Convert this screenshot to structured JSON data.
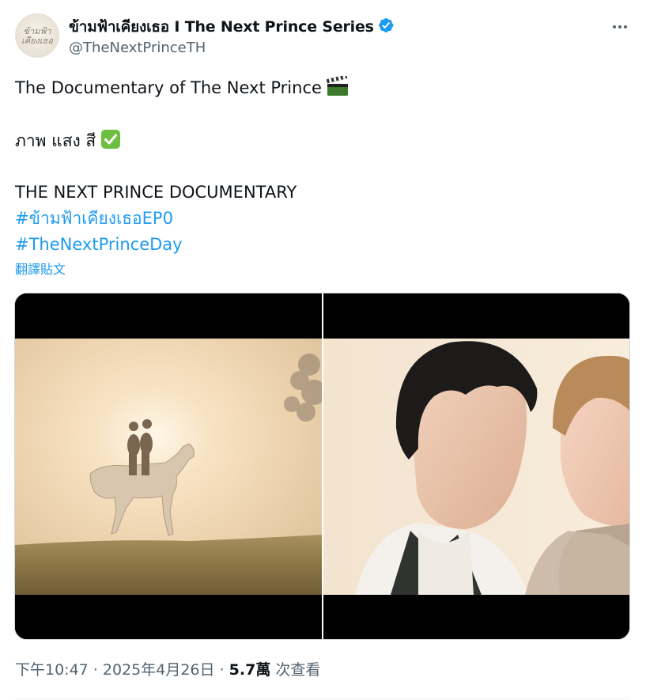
{
  "author": {
    "display_name": "ข้ามฟ้าเคียงเธอ I The Next Prince Series",
    "handle": "@TheNextPrinceTH",
    "avatar_text": "ข้ามฟ้า\nเคียงเธอ",
    "verified": true,
    "verified_color": "#1d9bf0"
  },
  "more_icon": "more-horizontal-icon",
  "tweet": {
    "line1": "The Documentary of The Next Prince",
    "line1_emoji": "clapper-board-emoji",
    "line2": "ภาพ แสง สี",
    "line2_emoji": "check-mark-button-emoji",
    "line3": "THE NEXT PRINCE DOCUMENTARY",
    "hashtag1": "#ข้ามฟ้าเคียงเธอEP0",
    "hashtag2": "#TheNextPrinceDay",
    "translate": "翻譯貼文"
  },
  "media": {
    "images": [
      {
        "description": "horseback-silhouette-image"
      },
      {
        "description": "two-actors-closeup-image"
      }
    ]
  },
  "meta": {
    "time": "下午10:47",
    "date": "2025年4月26日",
    "views_count": "5.7萬",
    "views_label": "次查看",
    "separator": "·"
  },
  "colors": {
    "link": "#1d9bf0",
    "secondary_text": "#536471",
    "primary_text": "#0f1419"
  }
}
